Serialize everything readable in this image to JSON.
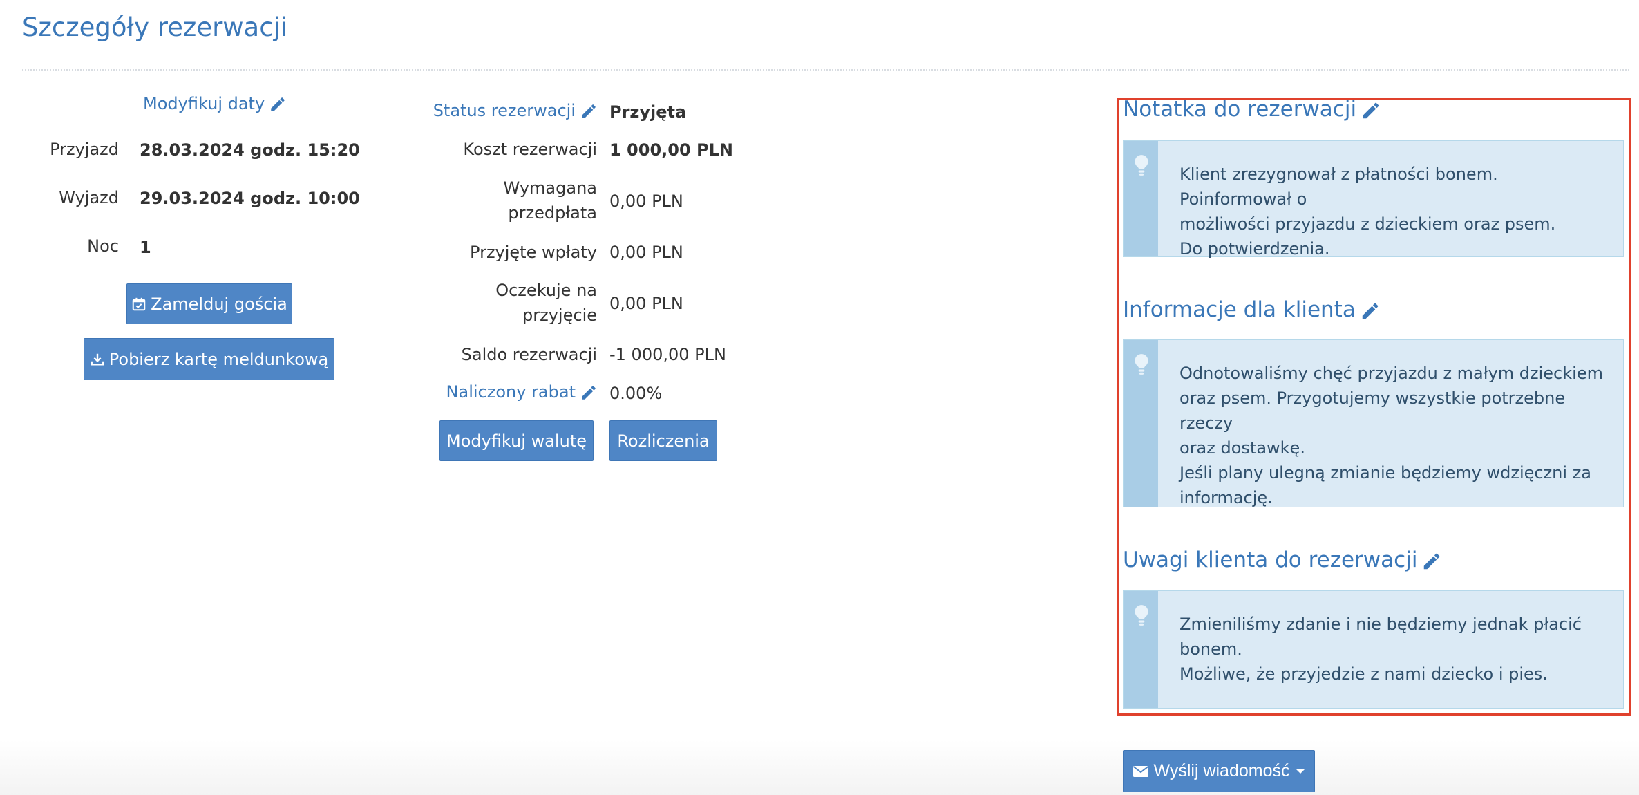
{
  "page": {
    "title": "Szczegóły rezerwacji"
  },
  "dates": {
    "modify_label": "Modyfikuj daty",
    "arrival_label": "Przyjazd",
    "arrival_value": "28.03.2024 godz. 15:20",
    "departure_label": "Wyjazd",
    "departure_value": "29.03.2024 godz. 10:00",
    "nights_label": "Noc",
    "nights_value": "1",
    "checkin_button": "Zamelduj gościa",
    "download_card_button": "Pobierz kartę meldunkową"
  },
  "finance": {
    "status_label": "Status rezerwacji",
    "status_value": "Przyjęta",
    "cost_label": "Koszt rezerwacji",
    "cost_value": "1 000,00 PLN",
    "prepayment_label_1": "Wymagana",
    "prepayment_label_2": "przedpłata",
    "prepayment_value": "0,00 PLN",
    "received_label": "Przyjęte wpłaty",
    "received_value": "0,00 PLN",
    "pending_label_1": "Oczekuje na",
    "pending_label_2": "przyjęcie",
    "pending_value": "0,00 PLN",
    "balance_label": "Saldo rezerwacji",
    "balance_value": "-1 000,00 PLN",
    "discount_label": "Naliczony rabat",
    "discount_value": "0.00%",
    "currency_button": "Modyfikuj walutę",
    "settlements_button": "Rozliczenia"
  },
  "notes": {
    "note_title": "Notatka do rezerwacji",
    "note_text": "Klient zrezygnował z płatności bonem. Poinformował o\nmożliwości przyjazdu z dzieckiem oraz psem.\nDo potwierdzenia.",
    "client_info_title": "Informacje dla klienta",
    "client_info_text": "Odnotowaliśmy chęć przyjazdu z małym dzieckiem\noraz psem. Przygotujemy wszystkie potrzebne rzeczy\noraz dostawkę.\nJeśli plany ulegną zmianie będziemy wdzięczni za\ninformację.",
    "client_remarks_title": "Uwagi klienta do rezerwacji",
    "client_remarks_text": "Zmieniliśmy zdanie i nie będziemy jednak płacić\nbonem.\nMożliwe, że przyjedzie z nami dziecko i pies."
  },
  "actions": {
    "send_message_button": "Wyślij wiadomość"
  },
  "colors": {
    "accent": "#4f86c6",
    "link": "#3a77b8",
    "note_bg": "#dbeaf5",
    "note_strip": "#a9cde6",
    "highlight": "#e0412d"
  },
  "icons": [
    "pencil-icon",
    "calendar-check-icon",
    "download-icon",
    "lightbulb-icon",
    "envelope-icon",
    "caret-down-icon"
  ]
}
